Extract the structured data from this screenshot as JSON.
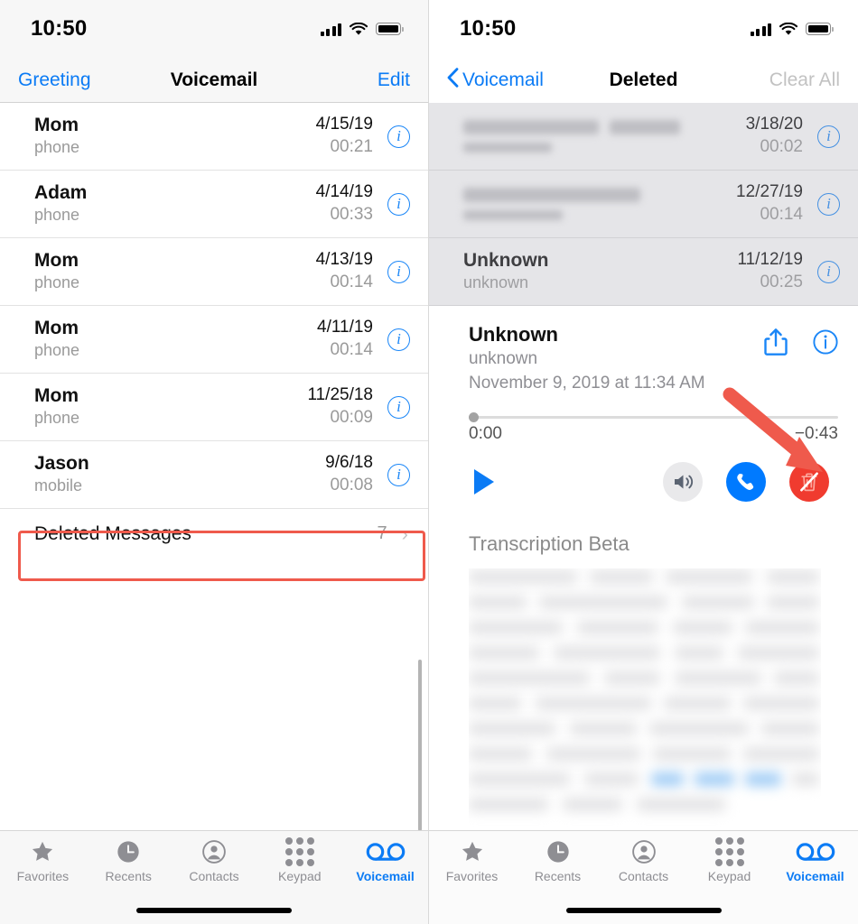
{
  "colors": {
    "accent_blue": "#0b7bf5",
    "info_blue": "#1a86f7",
    "call_blue": "#007aff",
    "undelete_red": "#f03b2f",
    "annotation_red": "#ef5a4c",
    "muted_gray": "#8e8e93"
  },
  "left_screen": {
    "status_bar": {
      "time": "10:50",
      "cellular": "signal-bars",
      "wifi": "wifi-icon",
      "battery": "battery-icon"
    },
    "nav": {
      "left_label": "Greeting",
      "title": "Voicemail",
      "right_label": "Edit"
    },
    "messages": [
      {
        "name": "Mom",
        "label": "phone",
        "date": "4/15/19",
        "duration": "00:21"
      },
      {
        "name": "Adam",
        "label": "phone",
        "date": "4/14/19",
        "duration": "00:33"
      },
      {
        "name": "Mom",
        "label": "phone",
        "date": "4/13/19",
        "duration": "00:14"
      },
      {
        "name": "Mom",
        "label": "phone",
        "date": "4/11/19",
        "duration": "00:14"
      },
      {
        "name": "Mom",
        "label": "phone",
        "date": "11/25/18",
        "duration": "00:09"
      },
      {
        "name": "Jason",
        "label": "mobile",
        "date": "9/6/18",
        "duration": "00:08"
      }
    ],
    "deleted_messages_row": {
      "label": "Deleted Messages",
      "count": "7",
      "chevron": "chevron-right-icon"
    },
    "tabbar": [
      {
        "label": "Favorites",
        "icon": "star-icon",
        "active": false
      },
      {
        "label": "Recents",
        "icon": "clock-icon",
        "active": false
      },
      {
        "label": "Contacts",
        "icon": "person-icon",
        "active": false
      },
      {
        "label": "Keypad",
        "icon": "keypad-icon",
        "active": false
      },
      {
        "label": "Voicemail",
        "icon": "voicemail-icon",
        "active": true
      }
    ]
  },
  "right_screen": {
    "status_bar": {
      "time": "10:50",
      "cellular": "signal-bars",
      "wifi": "wifi-icon",
      "battery": "battery-icon"
    },
    "nav": {
      "back_label": "Voicemail",
      "title": "Deleted",
      "right_label": "Clear All",
      "right_disabled": true
    },
    "deleted_list": [
      {
        "name": "",
        "label": "",
        "date": "3/18/20",
        "duration": "00:02",
        "redacted": true
      },
      {
        "name": "",
        "label": "",
        "date": "12/27/19",
        "duration": "00:14",
        "redacted": true
      },
      {
        "name": "Unknown",
        "label": "unknown",
        "date": "11/12/19",
        "duration": "00:25",
        "redacted": false
      }
    ],
    "expanded": {
      "name": "Unknown",
      "sub": "unknown",
      "timestamp": "November 9, 2019 at 11:34 AM",
      "share_icon": "share-icon",
      "info_icon": "info-icon",
      "elapsed": "0:00",
      "remaining": "−0:43",
      "progress_percent": 0,
      "play_icon": "play-icon",
      "speaker_icon": "speaker-icon",
      "call_icon": "phone-call-icon",
      "undelete_icon": "trash-slash-icon",
      "transcription_heading": "Transcription Beta"
    },
    "tabbar": [
      {
        "label": "Favorites",
        "icon": "star-icon",
        "active": false
      },
      {
        "label": "Recents",
        "icon": "clock-icon",
        "active": false
      },
      {
        "label": "Contacts",
        "icon": "person-icon",
        "active": false
      },
      {
        "label": "Keypad",
        "icon": "keypad-icon",
        "active": false
      },
      {
        "label": "Voicemail",
        "icon": "voicemail-icon",
        "active": true
      }
    ]
  }
}
